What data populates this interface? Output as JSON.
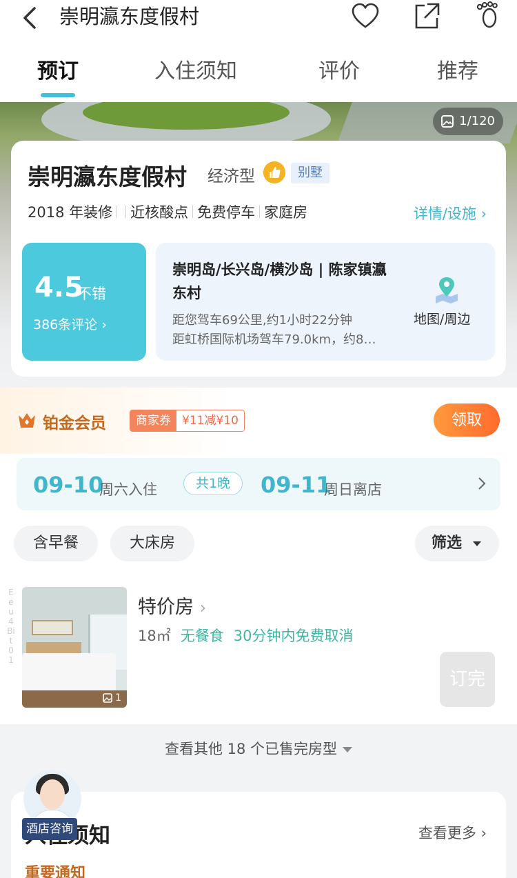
{
  "header": {
    "title": "崇明瀛东度假村"
  },
  "tabs": [
    {
      "label": "预订",
      "active": true
    },
    {
      "label": "入住须知"
    },
    {
      "label": "评价"
    },
    {
      "label": "推荐"
    }
  ],
  "hero": {
    "photo_count": "1/120"
  },
  "hotel": {
    "name": "崇明瀛东度假村",
    "type": "经济型",
    "villa_tag": "别墅",
    "facilities": [
      "2018 年装修",
      "近核酸点",
      "免费停车",
      "家庭房"
    ],
    "details_link": "详情/设施",
    "score": "4.5",
    "score_word": "不错",
    "review_count": "386条评论",
    "location_title": "崇明岛/长兴岛/横沙岛 | 陈家镇瀛东村",
    "distance_1": "距您驾车69公里,约1小时22分钟",
    "distance_2": "距虹桥国际机场驾车79.0km，约8…",
    "map_label": "地图/周边"
  },
  "member": {
    "label": "铂金会员",
    "coupon_a": "商家券",
    "coupon_b": "¥11减¥10",
    "claim": "领取"
  },
  "dates": {
    "checkin": "09-10",
    "checkin_label": "周六入住",
    "nights": "共1晚",
    "checkout": "09-11",
    "checkout_label": "周日离店"
  },
  "filters": {
    "chip1": "含早餐",
    "chip2": "大床房",
    "filter": "筛选"
  },
  "room": {
    "name": "特价房",
    "size": "18㎡",
    "meal": "无餐食",
    "cancel": "30分钟内免费取消",
    "image_count": "1",
    "soldout": "订完",
    "vertical_text": "Eeu4Bit01"
  },
  "more": {
    "label": "查看其他 18 个已售完房型"
  },
  "policy": {
    "title": "入住须知",
    "more": "查看更多",
    "sub": "重要通知"
  },
  "consult": {
    "label": "酒店咨询"
  },
  "colors": {
    "accent": "#3fb6cc",
    "score_bg": "#4cc9dc",
    "orange": "#ff6b2d"
  }
}
